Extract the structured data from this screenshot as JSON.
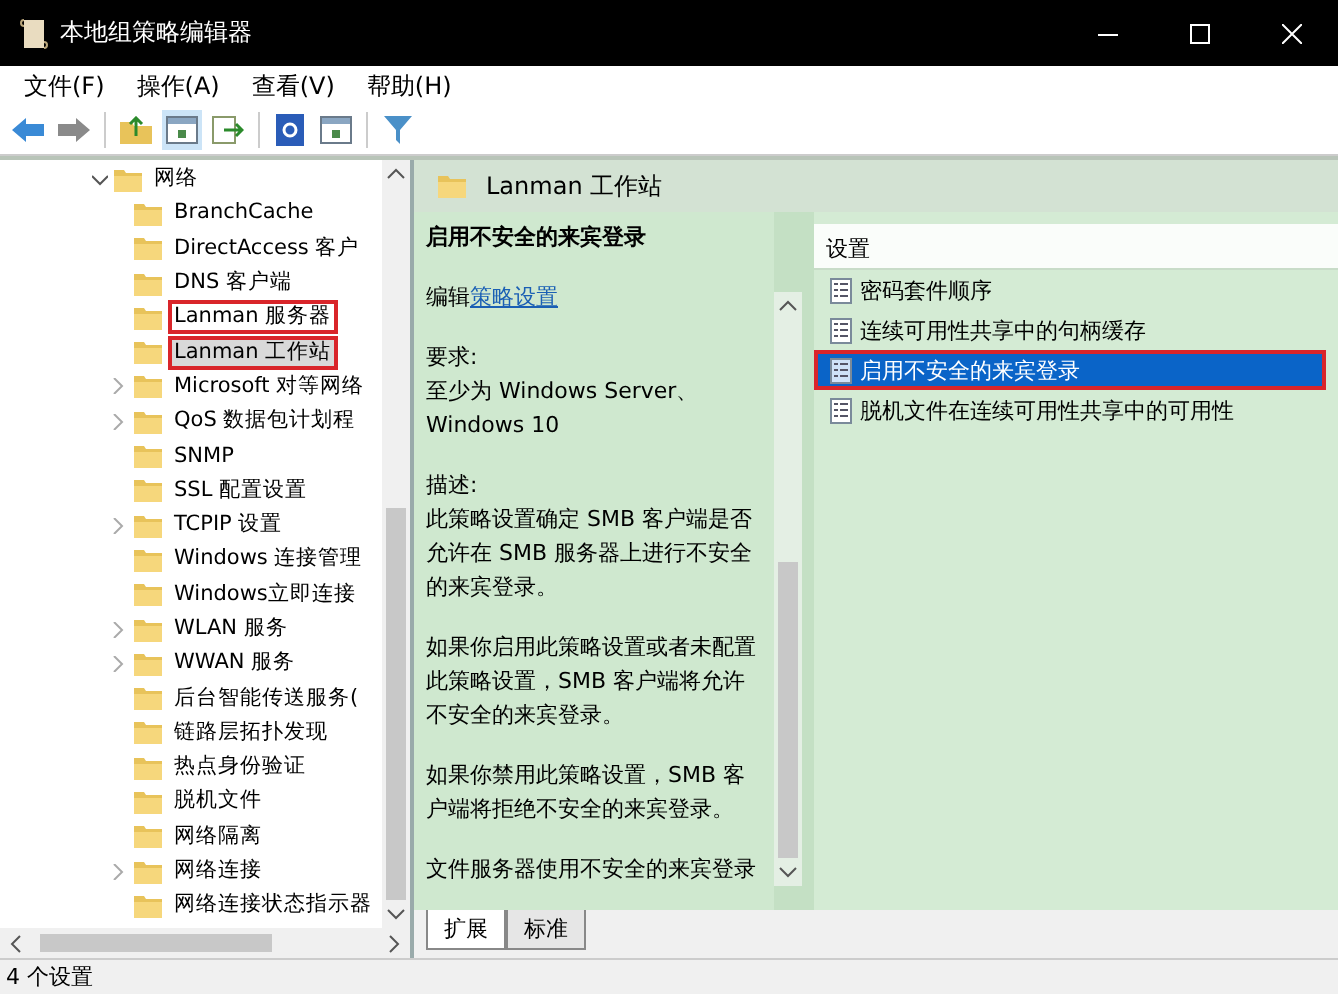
{
  "window": {
    "title": "本地组策略编辑器"
  },
  "menu": [
    "文件(F)",
    "操作(A)",
    "查看(V)",
    "帮助(H)"
  ],
  "tree": {
    "label": "网络",
    "expanded": true,
    "children": [
      {
        "label": "BranchCache",
        "expandable": false,
        "selected": false,
        "marked": false
      },
      {
        "label": "DirectAccess 客户",
        "expandable": false,
        "selected": false,
        "marked": false
      },
      {
        "label": "DNS 客户端",
        "expandable": false,
        "selected": false,
        "marked": false
      },
      {
        "label": "Lanman 服务器",
        "expandable": false,
        "selected": false,
        "marked": true
      },
      {
        "label": "Lanman 工作站",
        "expandable": false,
        "selected": true,
        "marked": true
      },
      {
        "label": "Microsoft 对等网络",
        "expandable": true,
        "selected": false,
        "marked": false
      },
      {
        "label": "QoS 数据包计划程",
        "expandable": true,
        "selected": false,
        "marked": false
      },
      {
        "label": "SNMP",
        "expandable": false,
        "selected": false,
        "marked": false
      },
      {
        "label": "SSL 配置设置",
        "expandable": false,
        "selected": false,
        "marked": false
      },
      {
        "label": "TCPIP 设置",
        "expandable": true,
        "selected": false,
        "marked": false
      },
      {
        "label": "Windows 连接管理",
        "expandable": false,
        "selected": false,
        "marked": false
      },
      {
        "label": "Windows立即连接",
        "expandable": false,
        "selected": false,
        "marked": false
      },
      {
        "label": "WLAN 服务",
        "expandable": true,
        "selected": false,
        "marked": false
      },
      {
        "label": "WWAN 服务",
        "expandable": true,
        "selected": false,
        "marked": false
      },
      {
        "label": "后台智能传送服务(",
        "expandable": false,
        "selected": false,
        "marked": false
      },
      {
        "label": "链路层拓扑发现",
        "expandable": false,
        "selected": false,
        "marked": false
      },
      {
        "label": "热点身份验证",
        "expandable": false,
        "selected": false,
        "marked": false
      },
      {
        "label": "脱机文件",
        "expandable": false,
        "selected": false,
        "marked": false
      },
      {
        "label": "网络隔离",
        "expandable": false,
        "selected": false,
        "marked": false
      },
      {
        "label": "网络连接",
        "expandable": true,
        "selected": false,
        "marked": false
      },
      {
        "label": "网络连接状态指示器",
        "expandable": false,
        "selected": false,
        "marked": false
      }
    ]
  },
  "pane_header": "Lanman 工作站",
  "description": {
    "title": "启用不安全的来宾登录",
    "edit_prefix": "编辑",
    "edit_link": "策略设置",
    "requirement_label": "要求:",
    "requirement": "至少为 Windows Server、Windows 10",
    "description_label": "描述:",
    "paragraphs": [
      "此策略设置确定 SMB 客户端是否允许在 SMB 服务器上进行不安全的来宾登录。",
      "如果你启用此策略设置或者未配置此策略设置，SMB 客户端将允许不安全的来宾登录。",
      "如果你禁用此策略设置，SMB 客户端将拒绝不安全的来宾登录。",
      "文件服务器使用不安全的来宾登录"
    ]
  },
  "settings": {
    "column": "设置",
    "rows": [
      {
        "name": "密码套件顺序",
        "selected": false,
        "marked": false
      },
      {
        "name": "连续可用性共享中的句柄缓存",
        "selected": false,
        "marked": false
      },
      {
        "name": "启用不安全的来宾登录",
        "selected": true,
        "marked": true
      },
      {
        "name": "脱机文件在连续可用性共享中的可用性",
        "selected": false,
        "marked": false
      }
    ]
  },
  "tabs": [
    {
      "label": "扩展",
      "selected": true
    },
    {
      "label": "标准",
      "selected": false
    }
  ],
  "status_bar": "4 个设置"
}
